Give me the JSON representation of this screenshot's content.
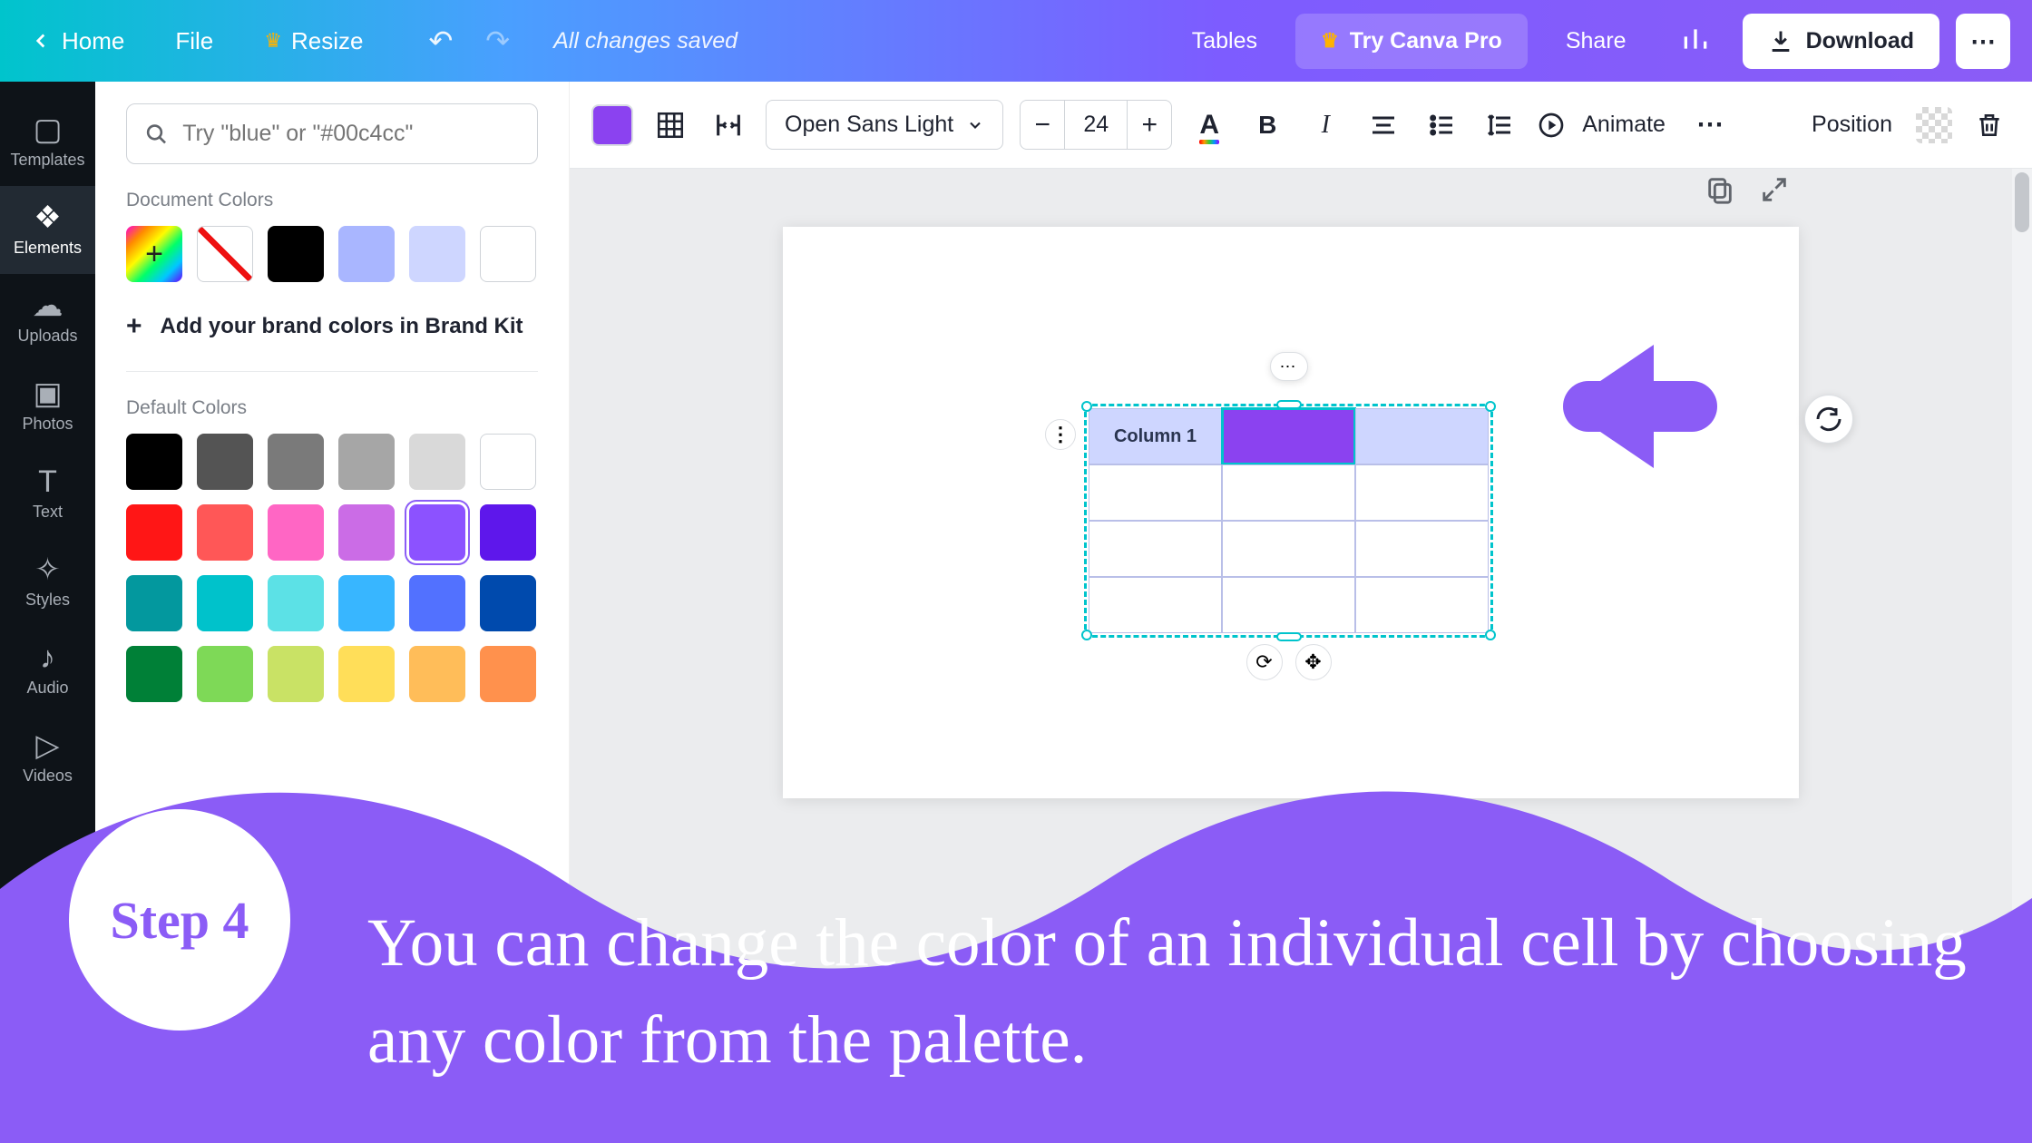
{
  "topbar": {
    "home": "Home",
    "file": "File",
    "resize": "Resize",
    "status": "All changes saved",
    "tables": "Tables",
    "tryPro": "Try Canva Pro",
    "share": "Share",
    "download": "Download"
  },
  "rail": [
    {
      "label": "Templates",
      "icon": "▢"
    },
    {
      "label": "Elements",
      "icon": "❖"
    },
    {
      "label": "Uploads",
      "icon": "☁"
    },
    {
      "label": "Photos",
      "icon": "▣"
    },
    {
      "label": "Text",
      "icon": "T"
    },
    {
      "label": "Styles",
      "icon": "✧"
    },
    {
      "label": "Audio",
      "icon": "♪"
    },
    {
      "label": "Videos",
      "icon": "▷"
    }
  ],
  "panel": {
    "searchPlaceholder": "Try \"blue\" or \"#00c4cc\"",
    "docColorsTitle": "Document Colors",
    "docColors": [
      "#000000",
      "#a9b6ff",
      "#ced6ff",
      "#ffffff"
    ],
    "brandKit": "Add your brand colors in Brand Kit",
    "defaultTitle": "Default Colors",
    "defaults": [
      "#000000",
      "#545454",
      "#7a7a7a",
      "#a6a6a6",
      "#d9d9d9",
      "#ffffff",
      "#ff1616",
      "#ff5757",
      "#ff66c4",
      "#cb6ce6",
      "#8c52ff",
      "#5e17eb",
      "#03989e",
      "#00c2cb",
      "#5ce1e6",
      "#38b6ff",
      "#5271ff",
      "#004aad",
      "#008037",
      "#7ed957",
      "#c9e265",
      "#ffde59",
      "#ffbd59",
      "#ff914d"
    ],
    "selectedDefault": "#8c52ff"
  },
  "toolbar": {
    "font": "Open Sans Light",
    "size": "24",
    "animate": "Animate",
    "position": "Position"
  },
  "table": {
    "col1": "Column 1"
  },
  "tutorial": {
    "step": "Step 4",
    "text": "You can change the color of an individual cell by choosing any color from the palette."
  }
}
